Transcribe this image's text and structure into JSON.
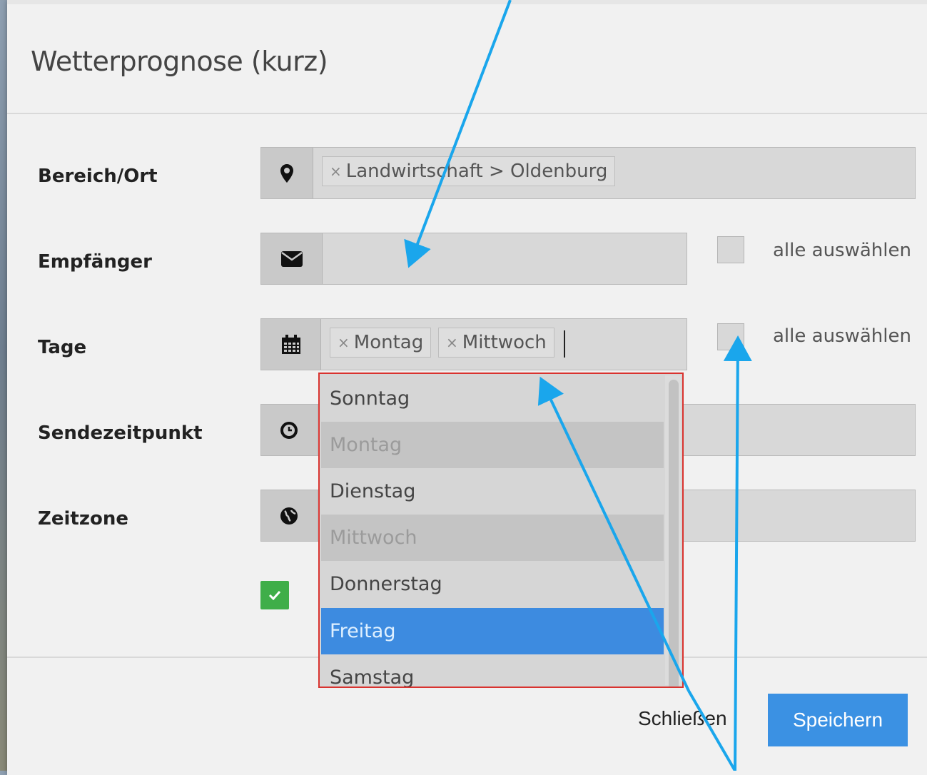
{
  "modal": {
    "title": "Wetterprognose (kurz)"
  },
  "form": {
    "bereich": {
      "label": "Bereich/Ort",
      "icon": "map-marker-icon",
      "tags": [
        "Landwirtschaft > Oldenburg"
      ]
    },
    "empfaenger": {
      "label": "Empfänger",
      "icon": "envelope-icon",
      "value": "",
      "select_all_label": "alle auswählen",
      "select_all_checked": false
    },
    "tage": {
      "label": "Tage",
      "icon": "calendar-icon",
      "tags": [
        "Montag",
        "Mittwoch"
      ],
      "select_all_label": "alle auswählen",
      "select_all_checked": false
    },
    "sendezeitpunkt": {
      "label": "Sendezeitpunkt",
      "icon": "clock-icon"
    },
    "zeitzone": {
      "label": "Zeitzone",
      "icon": "globe-icon"
    },
    "checkbox_checked": true
  },
  "dropdown": {
    "options": [
      {
        "label": "Sonntag",
        "state": "normal"
      },
      {
        "label": "Montag",
        "state": "disabled"
      },
      {
        "label": "Dienstag",
        "state": "normal"
      },
      {
        "label": "Mittwoch",
        "state": "disabled"
      },
      {
        "label": "Donnerstag",
        "state": "normal"
      },
      {
        "label": "Freitag",
        "state": "highlighted"
      },
      {
        "label": "Samstag",
        "state": "normal"
      }
    ]
  },
  "footer": {
    "close_label": "Schließen",
    "save_label": "Speichern"
  },
  "colors": {
    "primary": "#3b91e3",
    "highlight": "#3d8be0",
    "success": "#3fae49",
    "annotation_arrow": "#1aa6ec",
    "annotation_box": "#d9332f"
  },
  "tag_remove_symbol": "×"
}
